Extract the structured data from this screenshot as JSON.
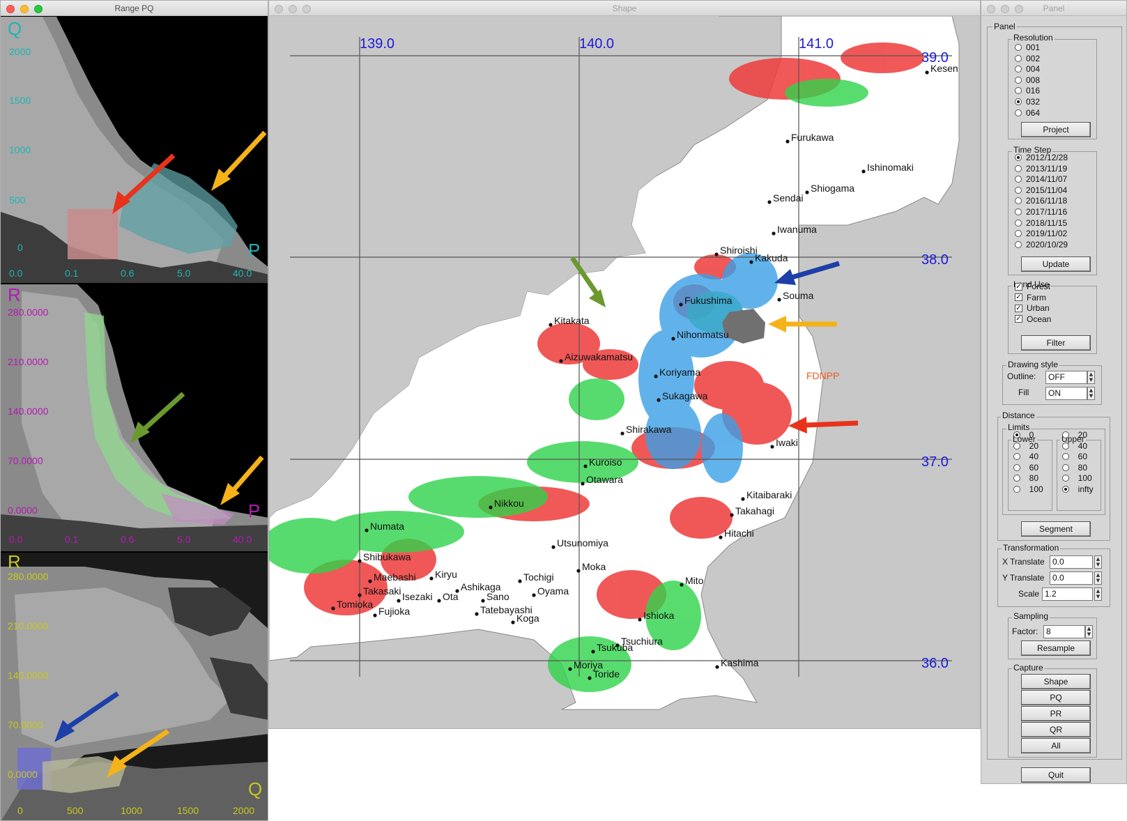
{
  "range_pq": {
    "title": "Range PQ",
    "plot1": {
      "y_letter": "Q",
      "x_letter": "P",
      "y_ticks": [
        "2000",
        "1500",
        "1000",
        "500",
        "0"
      ],
      "x_ticks": [
        "0.0",
        "0.1",
        "0.6",
        "5.0",
        "40.0"
      ],
      "color": "#1fb5b5"
    },
    "plot2": {
      "y_letter": "R",
      "x_letter": "P",
      "y_ticks": [
        "280.0000",
        "210.0000",
        "140.0000",
        "70.0000",
        "0.0000"
      ],
      "x_ticks": [
        "0.0",
        "0.1",
        "0.6",
        "5.0",
        "40.0"
      ],
      "color": "#b419b4"
    },
    "plot3": {
      "y_letter": "R",
      "x_letter": "Q",
      "y_ticks": [
        "280.0000",
        "210.0000",
        "140.0000",
        "70.0000",
        "0.0000"
      ],
      "x_ticks": [
        "0",
        "500",
        "1000",
        "1500",
        "2000"
      ],
      "color": "#c8c81e"
    }
  },
  "shape": {
    "title": "Shape",
    "lon_labels": [
      "139.0",
      "140.0",
      "141.0"
    ],
    "lat_labels": [
      "39.0",
      "38.0",
      "37.0",
      "36.0"
    ],
    "facility_label": "FDNPP",
    "cities": [
      {
        "name": "Kesen"
      },
      {
        "name": "Furukawa"
      },
      {
        "name": "Ishinomaki"
      },
      {
        "name": "Shiogama"
      },
      {
        "name": "Sendai"
      },
      {
        "name": "Iwanuma"
      },
      {
        "name": "Shiroishi"
      },
      {
        "name": "Kakuda"
      },
      {
        "name": "Souma"
      },
      {
        "name": "Fukushima"
      },
      {
        "name": "Nihonmatsu"
      },
      {
        "name": "Kitakata"
      },
      {
        "name": "Aizuwakamatsu"
      },
      {
        "name": "Koriyama"
      },
      {
        "name": "Sukagawa"
      },
      {
        "name": "Shirakawa"
      },
      {
        "name": "Iwaki"
      },
      {
        "name": "Kuroiso"
      },
      {
        "name": "Otawara"
      },
      {
        "name": "Kitaibaraki"
      },
      {
        "name": "Takahagi"
      },
      {
        "name": "Nikkou"
      },
      {
        "name": "Hitachi"
      },
      {
        "name": "Numata"
      },
      {
        "name": "Utsunomiya"
      },
      {
        "name": "Shibukawa"
      },
      {
        "name": "Moka"
      },
      {
        "name": "Maebashi"
      },
      {
        "name": "Kiryu"
      },
      {
        "name": "Tochigi"
      },
      {
        "name": "Ashikaga"
      },
      {
        "name": "Takasaki"
      },
      {
        "name": "Sano"
      },
      {
        "name": "Oyama"
      },
      {
        "name": "Mito"
      },
      {
        "name": "Isezaki"
      },
      {
        "name": "Ota"
      },
      {
        "name": "Tomioka"
      },
      {
        "name": "Tatebayashi"
      },
      {
        "name": "Fujioka"
      },
      {
        "name": "Koga"
      },
      {
        "name": "Ishioka"
      },
      {
        "name": "Tsuchiura"
      },
      {
        "name": "Tsukuba"
      },
      {
        "name": "Kashima"
      },
      {
        "name": "Moriya"
      },
      {
        "name": "Toride"
      }
    ]
  },
  "panel": {
    "title": "Panel",
    "outer_label": "Panel",
    "resolution": {
      "label": "Resolution",
      "options": [
        "001",
        "002",
        "004",
        "008",
        "016",
        "032",
        "064"
      ],
      "selected": "032",
      "button": "Project"
    },
    "time_step": {
      "label": "Time Step",
      "options": [
        "2012/12/28",
        "2013/11/19",
        "2014/11/07",
        "2015/11/04",
        "2016/11/18",
        "2017/11/16",
        "2018/11/15",
        "2019/11/02",
        "2020/10/29"
      ],
      "selected": "2012/12/28",
      "button": "Update"
    },
    "land_use": {
      "label": "Land Use",
      "items": [
        "Forest",
        "Farm",
        "Urban",
        "Ocean"
      ],
      "button": "Filter"
    },
    "drawing_style": {
      "label": "Drawing style",
      "outline_label": "Outline:",
      "outline_value": "OFF",
      "fill_label": "Fill",
      "fill_value": "ON"
    },
    "distance": {
      "label": "Distance",
      "limits_label": "Limits",
      "lower_label": "Lower",
      "lower_options": [
        "0",
        "20",
        "40",
        "60",
        "80",
        "100"
      ],
      "lower_selected": "0",
      "upper_label": "Upper",
      "upper_options": [
        "20",
        "40",
        "60",
        "80",
        "100",
        "infty"
      ],
      "upper_selected": "infty",
      "button": "Segment"
    },
    "transformation": {
      "label": "Transformation",
      "x_label": "X Translate",
      "x_value": "0.0",
      "y_label": "Y Translate",
      "y_value": "0.0",
      "scale_label": "Scale",
      "scale_value": "1.2"
    },
    "sampling": {
      "label": "Sampling",
      "factor_label": "Factor:",
      "factor_value": "8",
      "button": "Resample"
    },
    "capture": {
      "label": "Capture",
      "buttons": [
        "Shape",
        "PQ",
        "PR",
        "QR",
        "All"
      ]
    },
    "quit": "Quit"
  }
}
